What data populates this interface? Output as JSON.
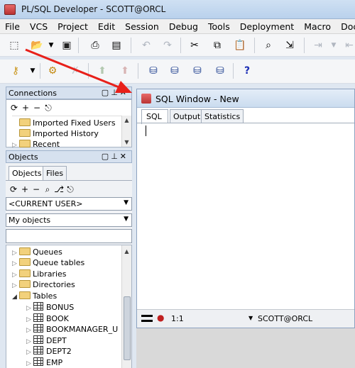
{
  "window": {
    "title": "PL/SQL Developer - SCOTT@ORCL"
  },
  "menu": [
    "File",
    "VCS",
    "Project",
    "Edit",
    "Session",
    "Debug",
    "Tools",
    "Deployment",
    "Macro",
    "Docume"
  ],
  "connections": {
    "title": "Connections",
    "items": [
      "Imported Fixed Users",
      "Imported History",
      "Recent"
    ]
  },
  "objects": {
    "title": "Objects",
    "tabs": [
      "Objects",
      "Files"
    ],
    "user_select": "<CURRENT USER>",
    "filter_select": "My objects",
    "search_value": "",
    "folders": [
      "Queues",
      "Queue tables",
      "Libraries",
      "Directories",
      "Tables"
    ],
    "tables": [
      "BONUS",
      "BOOK",
      "BOOKMANAGER_U",
      "DEPT",
      "DEPT2",
      "EMP"
    ]
  },
  "sql_window": {
    "title": "SQL Window - New",
    "tabs": [
      "SQL",
      "Output",
      "Statistics"
    ],
    "editor_text": "",
    "cursor_pos": "1:1",
    "connection": "SCOTT@ORCL"
  },
  "colors": {
    "arrow": "#e8201a",
    "accent": "#2b5fae"
  }
}
